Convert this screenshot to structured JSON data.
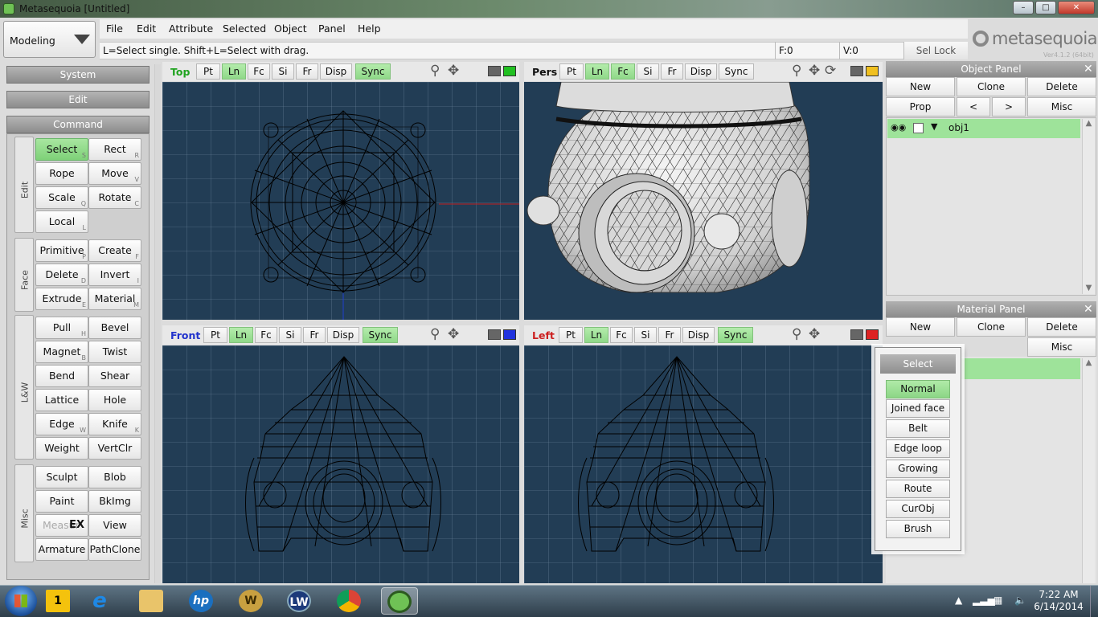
{
  "window": {
    "title": "Metasequoia [Untitled]"
  },
  "mode": {
    "selected": "Modeling"
  },
  "menu": [
    "File",
    "Edit",
    "Attribute",
    "Selected",
    "Object",
    "Panel",
    "Help"
  ],
  "status": {
    "hint": "L=Select single.  Shift+L=Select with drag.",
    "face_count": "F:0",
    "vertex_count": "V:0",
    "sel_lock": "Sel Lock"
  },
  "logo": {
    "name": "metasequoia",
    "number": "4",
    "version": "Ver4.1.2 (64bit)"
  },
  "side": {
    "system": "System",
    "edit": "Edit",
    "command": "Command"
  },
  "groups": {
    "edit": "Edit",
    "face": "Face",
    "lw": "L&W",
    "misc": "Misc"
  },
  "commands": {
    "select": {
      "label": "Select",
      "key": "S"
    },
    "rect": {
      "label": "Rect",
      "key": "R"
    },
    "rope": {
      "label": "Rope",
      "key": ""
    },
    "move": {
      "label": "Move",
      "key": "V"
    },
    "scale": {
      "label": "Scale",
      "key": "Q"
    },
    "rotate": {
      "label": "Rotate",
      "key": "C"
    },
    "local": {
      "label": "Local",
      "key": "L"
    },
    "primitive": {
      "label": "Primitive",
      "key": "P"
    },
    "create": {
      "label": "Create",
      "key": "F"
    },
    "delete": {
      "label": "Delete",
      "key": "D"
    },
    "invert": {
      "label": "Invert",
      "key": "I"
    },
    "extrude": {
      "label": "Extrude",
      "key": "E"
    },
    "material": {
      "label": "Material",
      "key": "M"
    },
    "pull": {
      "label": "Pull",
      "key": "H"
    },
    "bevel": {
      "label": "Bevel",
      "key": ""
    },
    "magnet": {
      "label": "Magnet",
      "key": "B"
    },
    "twist": {
      "label": "Twist",
      "key": ""
    },
    "bend": {
      "label": "Bend",
      "key": ""
    },
    "shear": {
      "label": "Shear",
      "key": ""
    },
    "lattice": {
      "label": "Lattice",
      "key": ""
    },
    "hole": {
      "label": "Hole",
      "key": ""
    },
    "edge": {
      "label": "Edge",
      "key": "W"
    },
    "knife": {
      "label": "Knife",
      "key": "K"
    },
    "weight": {
      "label": "Weight",
      "key": ""
    },
    "vertclr": {
      "label": "VertClr",
      "key": ""
    },
    "sculpt": {
      "label": "Sculpt",
      "key": ""
    },
    "blob": {
      "label": "Blob",
      "key": ""
    },
    "paint": {
      "label": "Paint",
      "key": ""
    },
    "bkimg": {
      "label": "BkImg",
      "key": ""
    },
    "measure": {
      "label": "Measur",
      "badge": "EX"
    },
    "view": {
      "label": "View",
      "key": ""
    },
    "armature": {
      "label": "Armature",
      "key": ""
    },
    "pathclone": {
      "label": "PathClone",
      "key": ""
    }
  },
  "viewports": {
    "top": {
      "name": "Top",
      "color": "#1fa31f",
      "monitor": "#22c022"
    },
    "pers": {
      "name": "Pers",
      "color": "#111111",
      "monitor": "#f0c020"
    },
    "front": {
      "name": "Front",
      "color": "#2233cc",
      "monitor": "#2233dd"
    },
    "left": {
      "name": "Left",
      "color": "#cc2020",
      "monitor": "#dd2222"
    },
    "buttons": {
      "pt": "Pt",
      "ln": "Ln",
      "fc": "Fc",
      "si": "Si",
      "fr": "Fr",
      "disp": "Disp",
      "sync": "Sync"
    }
  },
  "object_panel": {
    "title": "Object Panel",
    "new": "New",
    "clone": "Clone",
    "delete": "Delete",
    "prop": "Prop",
    "prev": "<",
    "next": ">",
    "misc": "Misc",
    "object_name": "obj1"
  },
  "material_panel": {
    "title": "Material Panel",
    "new": "New",
    "clone": "Clone",
    "delete": "Delete",
    "misc": "Misc"
  },
  "select_popup": {
    "title": "Select",
    "items": [
      "Normal",
      "Joined face",
      "Belt",
      "Edge loop",
      "Growing",
      "Route",
      "CurObj",
      "Brush"
    ],
    "active": "Normal"
  },
  "taskbar": {
    "time": "7:22 AM",
    "date": "6/14/2014"
  }
}
